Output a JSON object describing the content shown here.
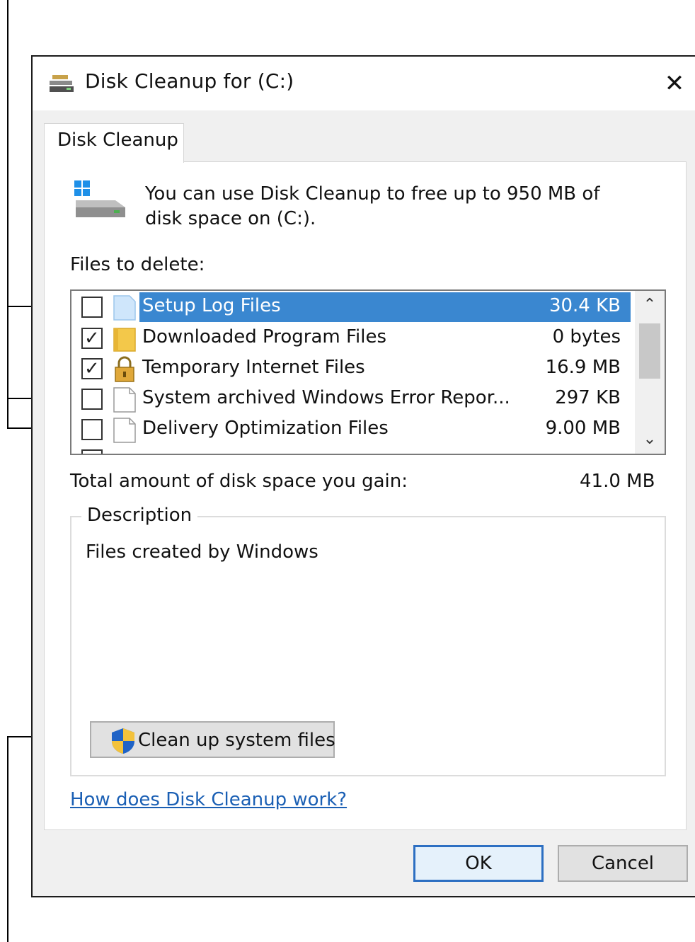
{
  "window": {
    "title": "Disk Cleanup for  (C:)",
    "close_glyph": "✕"
  },
  "tab": {
    "label": "Disk Cleanup"
  },
  "info": {
    "text": "You can use Disk Cleanup to free up to 950 MB of disk space on  (C:)."
  },
  "files_label": "Files to delete:",
  "files": [
    {
      "name": "Setup Log Files",
      "size": "30.4 KB",
      "checked": false,
      "selected": true,
      "icon": "file-blue-icon"
    },
    {
      "name": "Downloaded Program Files",
      "size": "0 bytes",
      "checked": true,
      "selected": false,
      "icon": "folder-icon"
    },
    {
      "name": "Temporary Internet Files",
      "size": "16.9 MB",
      "checked": true,
      "selected": false,
      "icon": "lock-icon"
    },
    {
      "name": "System archived Windows Error Repor...",
      "size": "297 KB",
      "checked": false,
      "selected": false,
      "icon": "file-icon"
    },
    {
      "name": "Delivery Optimization Files",
      "size": "9.00 MB",
      "checked": false,
      "selected": false,
      "icon": "file-icon"
    }
  ],
  "scrollbar": {
    "up_glyph": "⌃",
    "down_glyph": "⌄"
  },
  "total": {
    "label": "Total amount of disk space you gain:",
    "value": "41.0 MB"
  },
  "description": {
    "legend": "Description",
    "text": "Files created by Windows"
  },
  "cleanup_button": {
    "label": "Clean up system files",
    "icon": "uac-shield-icon"
  },
  "help_link": "How does Disk Cleanup work?",
  "buttons": {
    "ok": "OK",
    "cancel": "Cancel"
  },
  "colors": {
    "selection": "#3a87d0",
    "link": "#1a5fb4",
    "ok_border": "#2d6fc2"
  }
}
